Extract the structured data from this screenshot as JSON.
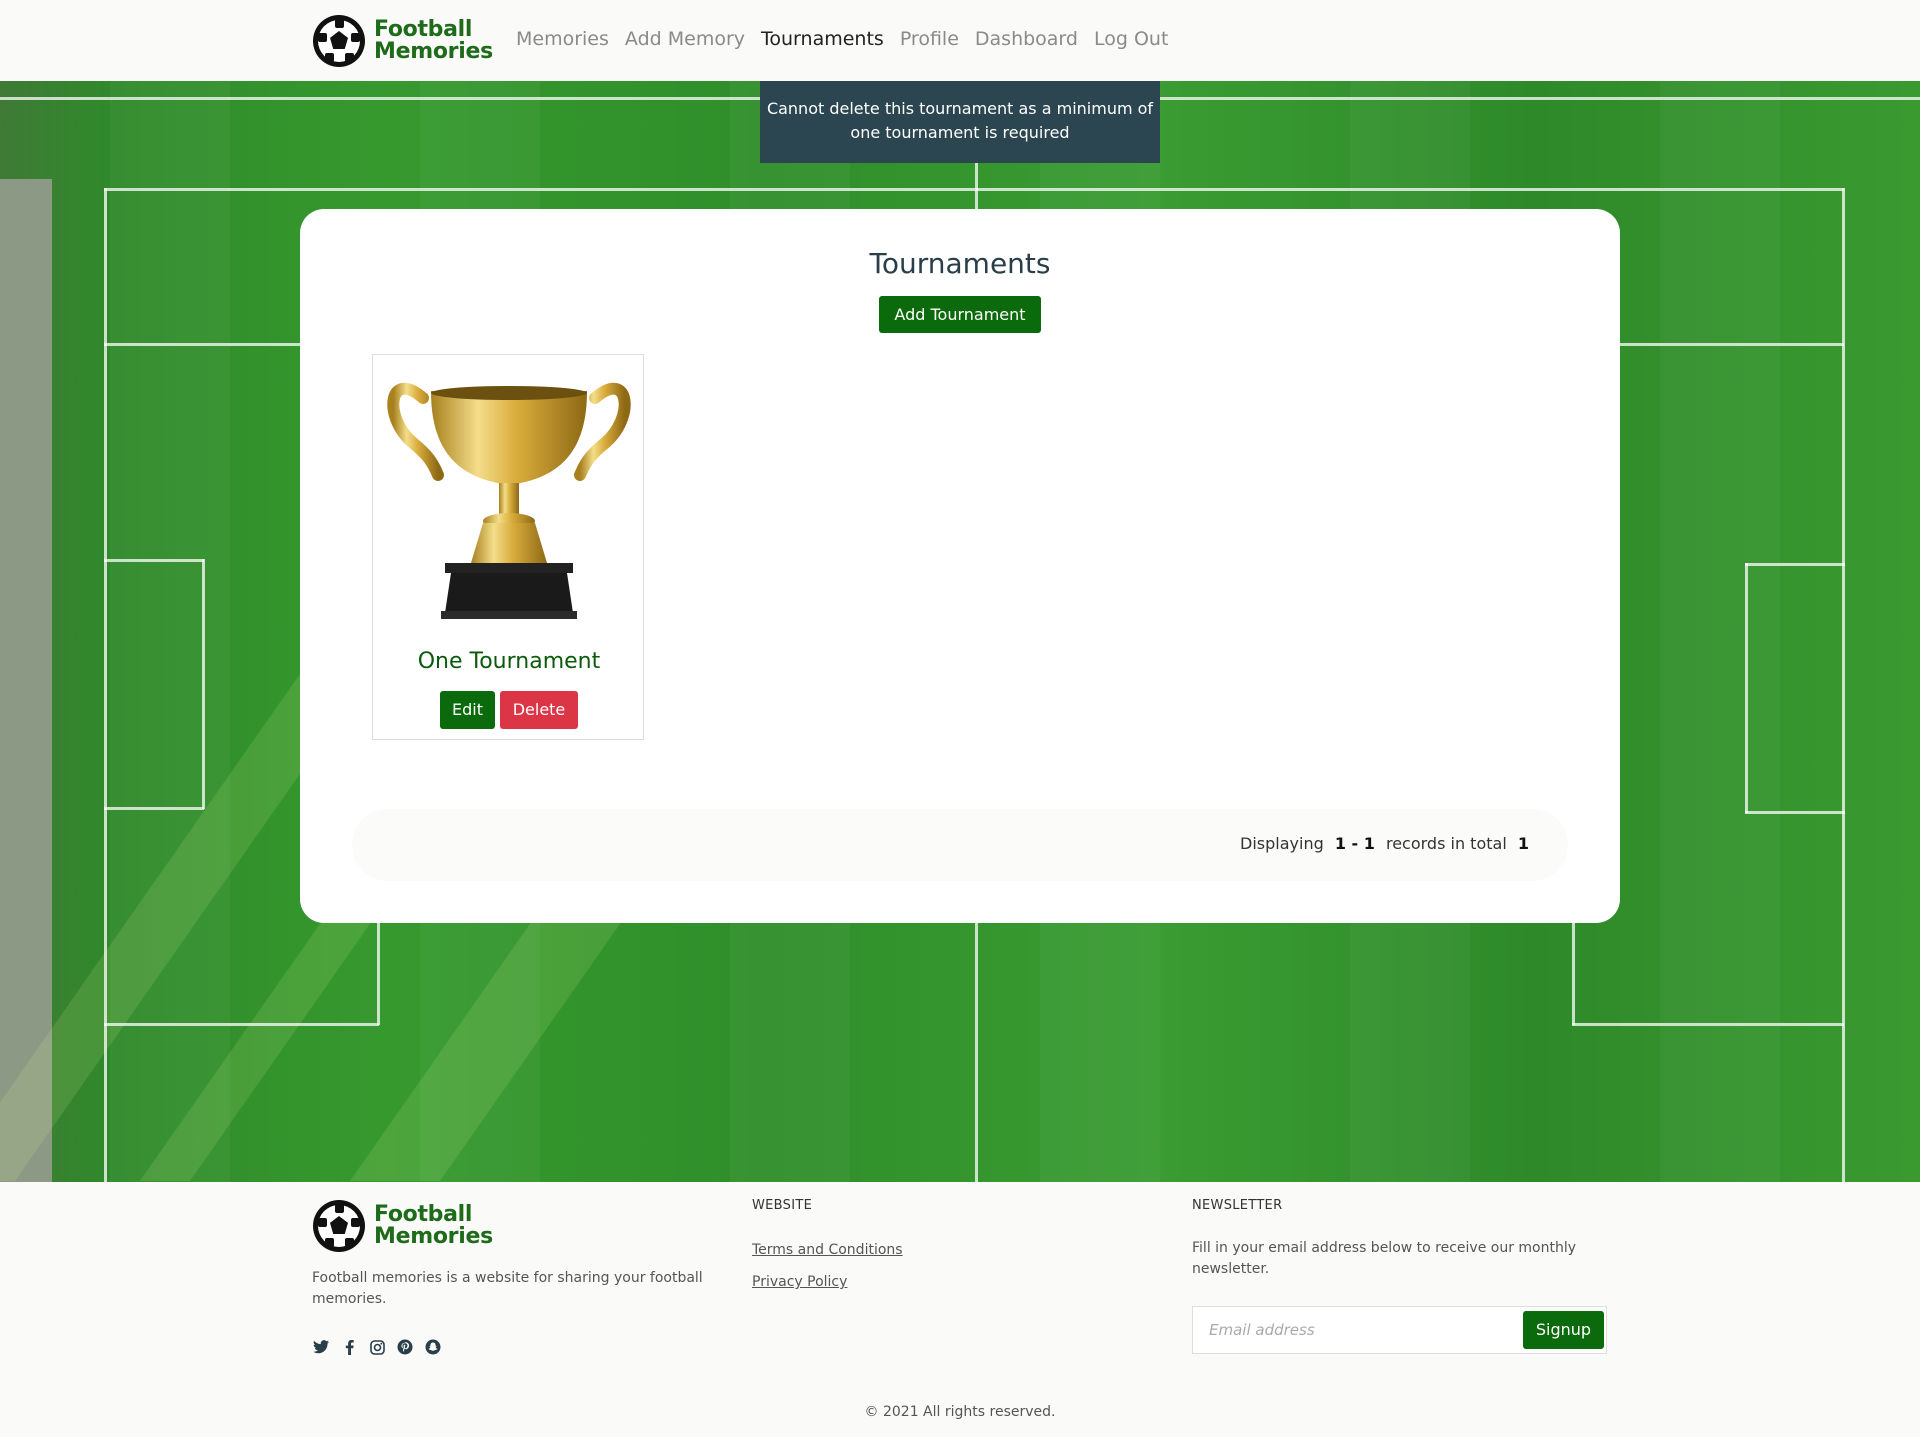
{
  "header": {
    "brand_line1": "Football",
    "brand_line2": "Memories",
    "nav": [
      {
        "label": "Memories"
      },
      {
        "label": "Add Memory"
      },
      {
        "label": "Tournaments",
        "active": true
      },
      {
        "label": "Profile"
      },
      {
        "label": "Dashboard"
      },
      {
        "label": "Log Out"
      }
    ]
  },
  "toast": {
    "message": "Cannot delete this tournament as a minimum of one tournament is required"
  },
  "main": {
    "title": "Tournaments",
    "add_button": "Add Tournament",
    "tournaments": [
      {
        "name": "One Tournament",
        "image": "trophy-icon",
        "edit_label": "Edit",
        "delete_label": "Delete"
      }
    ],
    "pagination": {
      "prefix": "Displaying",
      "range": "1 - 1",
      "middle": "records in total",
      "total": "1"
    }
  },
  "footer": {
    "brand_line1": "Football",
    "brand_line2": "Memories",
    "description": "Football memories is a website for sharing your football memories.",
    "social": [
      "twitter-icon",
      "facebook-icon",
      "instagram-icon",
      "pinterest-icon",
      "snapchat-icon"
    ],
    "website_title": "WEBSITE",
    "links": [
      "Terms and Conditions",
      "Privacy Policy"
    ],
    "newsletter_title": "NEWSLETTER",
    "newsletter_desc": "Fill in your email address below to receive our monthly newsletter.",
    "email_placeholder": "Email address",
    "signup_label": "Signup",
    "copyright": "© 2021 All rights reserved."
  },
  "colors": {
    "brand_green": "#0b6a0b",
    "danger_red": "#dc3545",
    "toast_bg": "#2b4650"
  }
}
